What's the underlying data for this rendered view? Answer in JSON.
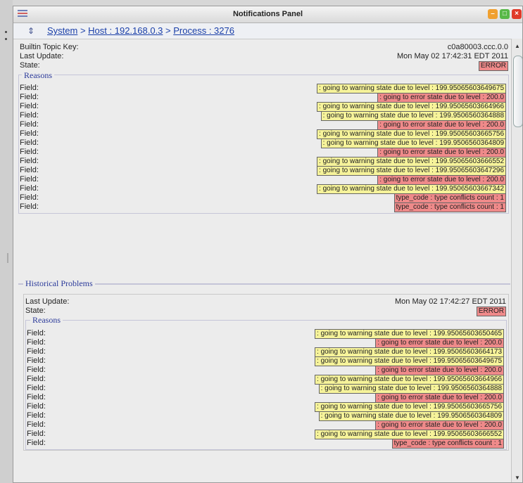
{
  "window": {
    "title": "Notifications Panel"
  },
  "breadcrumb": {
    "system": "System",
    "sep1": " > ",
    "host": "Host : 192.168.0.3",
    "sep2": " > ",
    "process": "Process : 3276"
  },
  "current": {
    "topic_key_label": "Builtin Topic Key:",
    "topic_key_value": "c0a80003.ccc.0.0",
    "last_update_label": "Last Update:",
    "last_update_value": "Mon May 02 17:42:31 EDT 2011",
    "state_label": "State:",
    "state_value": "ERROR",
    "reasons_title": "Reasons",
    "field_label": "Field:",
    "fields": [
      {
        "text": ": going to warning state due to level : 199.95065603649675",
        "kind": "warn"
      },
      {
        "text": ": going to error state due to level : 200.0",
        "kind": "err"
      },
      {
        "text": ": going to warning state due to level : 199.95065603664966",
        "kind": "warn"
      },
      {
        "text": ": going to warning state due to level : 199.9506560364888",
        "kind": "warn"
      },
      {
        "text": ": going to error state due to level : 200.0",
        "kind": "err"
      },
      {
        "text": ": going to warning state due to level : 199.95065603665756",
        "kind": "warn"
      },
      {
        "text": ": going to warning state due to level : 199.9506560364809",
        "kind": "warn"
      },
      {
        "text": ": going to error state due to level : 200.0",
        "kind": "err"
      },
      {
        "text": ": going to warning state due to level : 199.95065603666552",
        "kind": "warn"
      },
      {
        "text": ": going to warning state due to level : 199.95065603647296",
        "kind": "warn"
      },
      {
        "text": ": going to error state due to level : 200.0",
        "kind": "err"
      },
      {
        "text": ": going to warning state due to level : 199.95065603667342",
        "kind": "warn"
      },
      {
        "text": "type_code : type conflicts count : 1",
        "kind": "err"
      },
      {
        "text": "type_code : type conflicts count : 1",
        "kind": "err"
      }
    ]
  },
  "historical": {
    "title": "Historical Problems",
    "last_update_label": "Last Update:",
    "last_update_value": "Mon May 02 17:42:27 EDT 2011",
    "state_label": "State:",
    "state_value": "ERROR",
    "reasons_title": "Reasons",
    "field_label": "Field:",
    "fields": [
      {
        "text": ": going to warning state due to level : 199.95065603650465",
        "kind": "warn"
      },
      {
        "text": ": going to error state due to level : 200.0",
        "kind": "err"
      },
      {
        "text": ": going to warning state due to level : 199.95065603664173",
        "kind": "warn"
      },
      {
        "text": ": going to warning state due to level : 199.95065603649675",
        "kind": "warn"
      },
      {
        "text": ": going to error state due to level : 200.0",
        "kind": "err"
      },
      {
        "text": ": going to warning state due to level : 199.95065603664966",
        "kind": "warn"
      },
      {
        "text": ": going to warning state due to level : 199.9506560364888",
        "kind": "warn"
      },
      {
        "text": ": going to error state due to level : 200.0",
        "kind": "err"
      },
      {
        "text": ": going to warning state due to level : 199.95065603665756",
        "kind": "warn"
      },
      {
        "text": ": going to warning state due to level : 199.9506560364809",
        "kind": "warn"
      },
      {
        "text": ": going to error state due to level : 200.0",
        "kind": "err"
      },
      {
        "text": ": going to warning state due to level : 199.95065603666552",
        "kind": "warn"
      },
      {
        "text": "type_code : type conflicts count : 1",
        "kind": "err"
      }
    ]
  },
  "colors": {
    "warn": "#f6f39a",
    "error": "#ef8a8a",
    "link": "#1a3fa8",
    "legend": "#2b3a9a"
  },
  "icons": [
    "app-menu-icon",
    "pin-icon",
    "minimize-icon",
    "maximize-icon",
    "close-icon",
    "scroll-up-icon",
    "scroll-down-icon"
  ]
}
